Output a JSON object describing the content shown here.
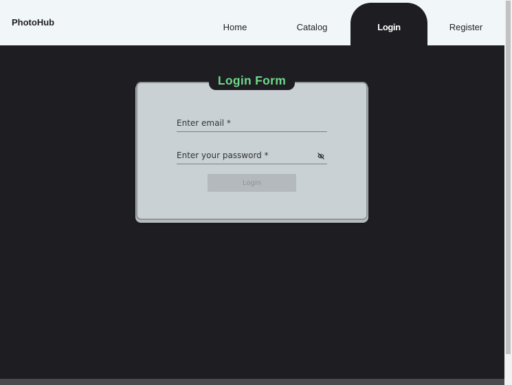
{
  "header": {
    "brand": "PhotoHub",
    "nav": [
      {
        "label": "Home"
      },
      {
        "label": "Catalog"
      },
      {
        "label": "Login",
        "active": true
      },
      {
        "label": "Register"
      }
    ]
  },
  "login_form": {
    "title": "Login Form",
    "email_placeholder": "Enter email *",
    "password_placeholder": "Enter your password *",
    "submit_label": "Login",
    "submit_disabled": true,
    "password_toggle_icon": "eye-off-icon"
  },
  "colors": {
    "page_background": "#1e1d22",
    "header_background": "#f1f6f9",
    "card_background": "#c9d1d4",
    "title_accent": "#6ed98a"
  }
}
